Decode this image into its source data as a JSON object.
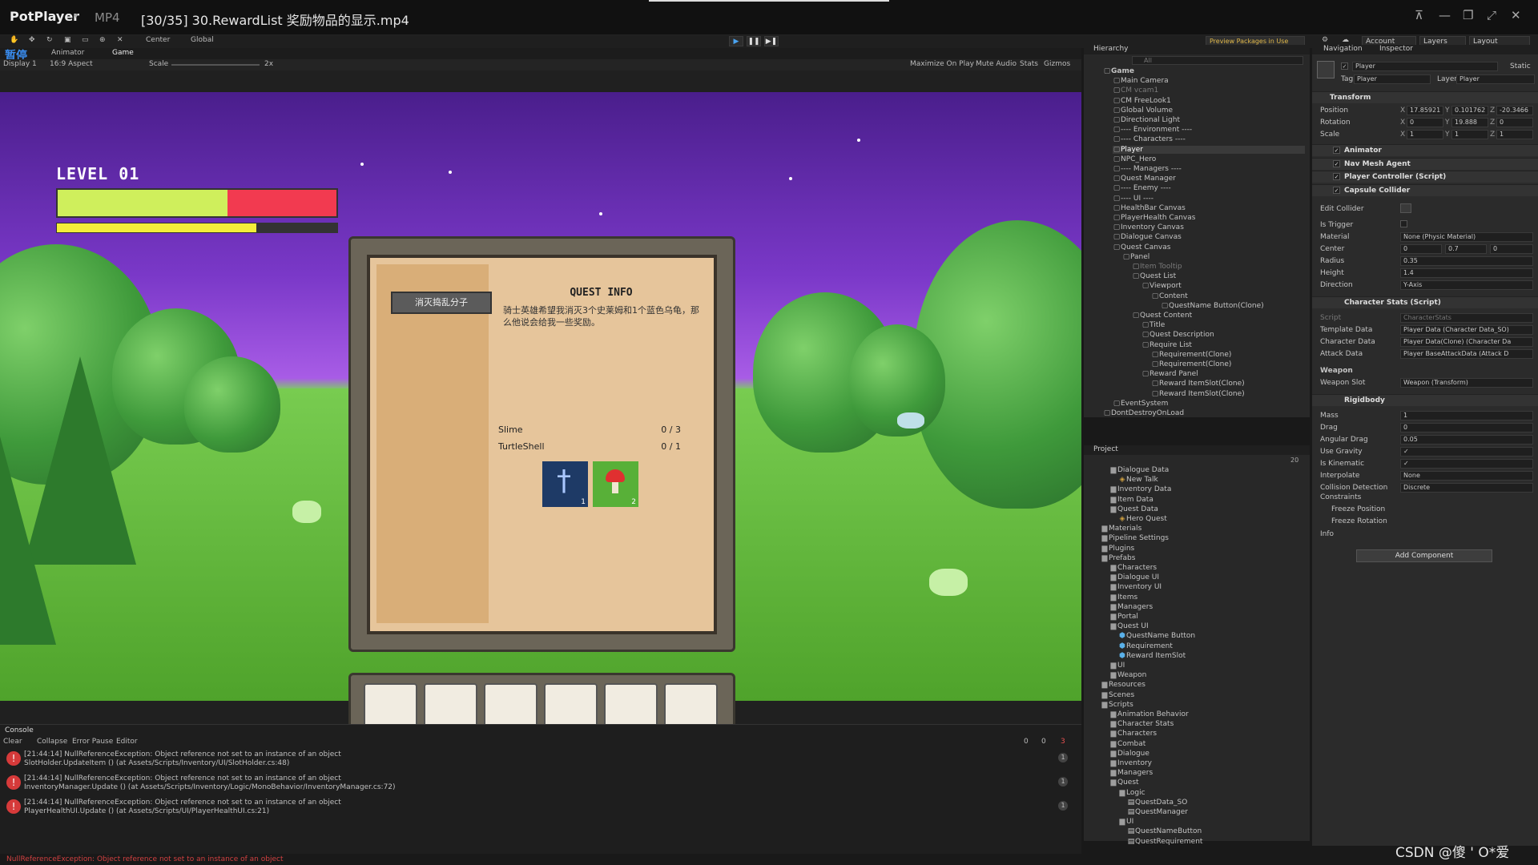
{
  "player": {
    "brand": "PotPlayer",
    "format": "MP4",
    "filename": "[30/35] 30.RewardList 奖励物品的显示.mp4",
    "paused_label": "暂停",
    "watermark": "CSDN @傻  ' O*爱"
  },
  "unity_toolbar": {
    "center": "Center",
    "global": "Global",
    "preview_packages": "Preview Packages in Use",
    "account": "Account",
    "layers": "Layers",
    "layout": "Layout"
  },
  "game_panel": {
    "tabs": [
      "Animator",
      "Game"
    ],
    "display": "Display 1",
    "aspect": "16:9 Aspect",
    "scale_label": "Scale",
    "scale_value": "2x",
    "options": [
      "Maximize On Play",
      "Mute Audio",
      "Stats",
      "Gizmos"
    ]
  },
  "hud": {
    "level_text": "LEVEL 01",
    "health_fraction": 0.61,
    "exp_fraction": 0.71,
    "health_color": "#cfef5c",
    "health_bg_color": "#f23a50",
    "exp_color": "#f3ee3b"
  },
  "quest_ui": {
    "quest_button": "消灭捣乱分子",
    "title": "QUEST INFO",
    "description": "骑士英雄希望我消灭3个史莱姆和1个蓝色乌龟，那么他说会给我一些奖励。",
    "requirements": [
      {
        "name": "Slime",
        "count": "0 / 3"
      },
      {
        "name": "TurtleShell",
        "count": "0 / 1"
      }
    ],
    "rewards": [
      {
        "icon": "sword-icon",
        "amount": "1",
        "color": "#1e3a66"
      },
      {
        "icon": "mushroom-icon",
        "amount": "2",
        "color": "#58b038"
      }
    ]
  },
  "console": {
    "tab": "Console",
    "buttons": [
      "Clear",
      "Collapse",
      "Error Pause",
      "Editor"
    ],
    "counts": [
      "0",
      "0",
      "3"
    ],
    "rows": [
      {
        "line1": "[21:44:14] NullReferenceException: Object reference not set to an instance of an object",
        "line2": "SlotHolder.UpdateItem () (at Assets/Scripts/Inventory/UI/SlotHolder.cs:48)",
        "count": "1"
      },
      {
        "line1": "[21:44:14] NullReferenceException: Object reference not set to an instance of an object",
        "line2": "InventoryManager.Update () (at Assets/Scripts/Inventory/Logic/MonoBehavior/InventoryManager.cs:72)",
        "count": "1"
      },
      {
        "line1": "[21:44:14] NullReferenceException: Object reference not set to an instance of an object",
        "line2": "PlayerHealthUI.Update () (at Assets/Scripts/UI/PlayerHealthUI.cs:21)",
        "count": "1"
      }
    ],
    "status": "NullReferenceException: Object reference not set to an instance of an object"
  },
  "hierarchy": {
    "title": "Hierarchy",
    "search_placeholder": "All",
    "items": [
      {
        "label": "Game",
        "indent": 0,
        "state": "bold"
      },
      {
        "label": "Main Camera",
        "indent": 1,
        "state": ""
      },
      {
        "label": "CM vcam1",
        "indent": 1,
        "state": "dim"
      },
      {
        "label": "CM FreeLook1",
        "indent": 1,
        "state": ""
      },
      {
        "label": "Global Volume",
        "indent": 1,
        "state": ""
      },
      {
        "label": "Directional Light",
        "indent": 1,
        "state": ""
      },
      {
        "label": "---- Environment ----",
        "indent": 1,
        "state": ""
      },
      {
        "label": "---- Characters ----",
        "indent": 1,
        "state": ""
      },
      {
        "label": "Player",
        "indent": 1,
        "state": "sel"
      },
      {
        "label": "NPC_Hero",
        "indent": 1,
        "state": ""
      },
      {
        "label": "---- Managers ----",
        "indent": 1,
        "state": ""
      },
      {
        "label": "Quest Manager",
        "indent": 1,
        "state": ""
      },
      {
        "label": "---- Enemy ----",
        "indent": 1,
        "state": ""
      },
      {
        "label": "---- UI ----",
        "indent": 1,
        "state": ""
      },
      {
        "label": "HealthBar Canvas",
        "indent": 1,
        "state": ""
      },
      {
        "label": "PlayerHealth Canvas",
        "indent": 1,
        "state": ""
      },
      {
        "label": "Inventory Canvas",
        "indent": 1,
        "state": ""
      },
      {
        "label": "Dialogue Canvas",
        "indent": 1,
        "state": ""
      },
      {
        "label": "Quest Canvas",
        "indent": 1,
        "state": ""
      },
      {
        "label": "Panel",
        "indent": 2,
        "state": ""
      },
      {
        "label": "Item Tooltip",
        "indent": 3,
        "state": "dim"
      },
      {
        "label": "Quest List",
        "indent": 3,
        "state": ""
      },
      {
        "label": "Viewport",
        "indent": 4,
        "state": ""
      },
      {
        "label": "Content",
        "indent": 5,
        "state": ""
      },
      {
        "label": "QuestName Button(Clone)",
        "indent": 6,
        "state": ""
      },
      {
        "label": "Quest Content",
        "indent": 3,
        "state": ""
      },
      {
        "label": "Title",
        "indent": 4,
        "state": ""
      },
      {
        "label": "Quest Description",
        "indent": 4,
        "state": ""
      },
      {
        "label": "Require List",
        "indent": 4,
        "state": ""
      },
      {
        "label": "Requirement(Clone)",
        "indent": 5,
        "state": ""
      },
      {
        "label": "Requirement(Clone)",
        "indent": 5,
        "state": ""
      },
      {
        "label": "Reward Panel",
        "indent": 4,
        "state": ""
      },
      {
        "label": "Reward ItemSlot(Clone)",
        "indent": 5,
        "state": ""
      },
      {
        "label": "Reward ItemSlot(Clone)",
        "indent": 5,
        "state": ""
      },
      {
        "label": "EventSystem",
        "indent": 1,
        "state": ""
      },
      {
        "label": "DontDestroyOnLoad",
        "indent": 0,
        "state": ""
      }
    ]
  },
  "project": {
    "title": "Project",
    "count": "20",
    "items": [
      {
        "label": "Dialogue Data",
        "indent": 2,
        "kind": "folder"
      },
      {
        "label": "New Talk",
        "indent": 3,
        "kind": "asset"
      },
      {
        "label": "Inventory Data",
        "indent": 2,
        "kind": "folder"
      },
      {
        "label": "Item Data",
        "indent": 2,
        "kind": "folder"
      },
      {
        "label": "Quest Data",
        "indent": 2,
        "kind": "folder"
      },
      {
        "label": "Hero Quest",
        "indent": 3,
        "kind": "asset"
      },
      {
        "label": "Materials",
        "indent": 1,
        "kind": "folder"
      },
      {
        "label": "Pipeline Settings",
        "indent": 1,
        "kind": "folder"
      },
      {
        "label": "Plugins",
        "indent": 1,
        "kind": "folder"
      },
      {
        "label": "Prefabs",
        "indent": 1,
        "kind": "folder"
      },
      {
        "label": "Characters",
        "indent": 2,
        "kind": "folder"
      },
      {
        "label": "Dialogue UI",
        "indent": 2,
        "kind": "folder"
      },
      {
        "label": "Inventory UI",
        "indent": 2,
        "kind": "folder"
      },
      {
        "label": "Items",
        "indent": 2,
        "kind": "folder"
      },
      {
        "label": "Managers",
        "indent": 2,
        "kind": "folder"
      },
      {
        "label": "Portal",
        "indent": 2,
        "kind": "folder"
      },
      {
        "label": "Quest UI",
        "indent": 2,
        "kind": "folder"
      },
      {
        "label": "QuestName Button",
        "indent": 3,
        "kind": "prefab"
      },
      {
        "label": "Requirement",
        "indent": 3,
        "kind": "prefab"
      },
      {
        "label": "Reward ItemSlot",
        "indent": 3,
        "kind": "prefab"
      },
      {
        "label": "UI",
        "indent": 2,
        "kind": "folder"
      },
      {
        "label": "Weapon",
        "indent": 2,
        "kind": "folder"
      },
      {
        "label": "Resources",
        "indent": 1,
        "kind": "folder"
      },
      {
        "label": "Scenes",
        "indent": 1,
        "kind": "folder"
      },
      {
        "label": "Scripts",
        "indent": 1,
        "kind": "folder"
      },
      {
        "label": "Animation Behavior",
        "indent": 2,
        "kind": "folder"
      },
      {
        "label": "Character Stats",
        "indent": 2,
        "kind": "folder"
      },
      {
        "label": "Characters",
        "indent": 2,
        "kind": "folder"
      },
      {
        "label": "Combat",
        "indent": 2,
        "kind": "folder"
      },
      {
        "label": "Dialogue",
        "indent": 2,
        "kind": "folder"
      },
      {
        "label": "Inventory",
        "indent": 2,
        "kind": "folder"
      },
      {
        "label": "Managers",
        "indent": 2,
        "kind": "folder"
      },
      {
        "label": "Quest",
        "indent": 2,
        "kind": "folder"
      },
      {
        "label": "Logic",
        "indent": 3,
        "kind": "folder"
      },
      {
        "label": "QuestData_SO",
        "indent": 4,
        "kind": "script"
      },
      {
        "label": "QuestManager",
        "indent": 4,
        "kind": "script"
      },
      {
        "label": "UI",
        "indent": 3,
        "kind": "folder"
      },
      {
        "label": "QuestNameButton",
        "indent": 4,
        "kind": "script"
      },
      {
        "label": "QuestRequirement",
        "indent": 4,
        "kind": "script"
      }
    ]
  },
  "inspector": {
    "tabs": [
      "Navigation",
      "Inspector"
    ],
    "object_name": "Player",
    "static_label": "Static",
    "tag_label": "Tag",
    "tag_value": "Player",
    "layer_label": "Layer",
    "layer_value": "Player",
    "transform": {
      "title": "Transform",
      "position": {
        "label": "Position",
        "x": "17.85921",
        "y": "0.101762",
        "z": "-20.3466"
      },
      "rotation": {
        "label": "Rotation",
        "x": "0",
        "y": "19.888",
        "z": "0"
      },
      "scale": {
        "label": "Scale",
        "x": "1",
        "y": "1",
        "z": "1"
      }
    },
    "components": [
      "Animator",
      "Nav Mesh Agent",
      "Player Controller (Script)",
      "Capsule Collider"
    ],
    "collider": {
      "edit": "Edit Collider",
      "is_trigger": "Is Trigger",
      "material_label": "Material",
      "material": "None (Physic Material)",
      "center_label": "Center",
      "center": {
        "x": "0",
        "y": "0.7",
        "z": "0"
      },
      "radius_label": "Radius",
      "radius": "0.35",
      "height_label": "Height",
      "height": "1.4",
      "direction_label": "Direction",
      "direction": "Y-Axis"
    },
    "stats": {
      "title": "Character Stats (Script)",
      "script_label": "Script",
      "script": "CharacterStats",
      "template_label": "Template Data",
      "template": "Player Data (Character Data_SO)",
      "char_label": "Character Data",
      "char": "Player Data(Clone) (Character Da",
      "attack_label": "Attack Data",
      "attack": "Player BaseAttackData (Attack D",
      "weapon_header": "Weapon",
      "weapon_label": "Weapon Slot",
      "weapon": "Weapon (Transform)"
    },
    "rigidbody": {
      "title": "Rigidbody",
      "rows": [
        {
          "label": "Mass",
          "value": "1"
        },
        {
          "label": "Drag",
          "value": "0"
        },
        {
          "label": "Angular Drag",
          "value": "0.05"
        },
        {
          "label": "Use Gravity",
          "value": "✓"
        },
        {
          "label": "Is Kinematic",
          "value": "✓"
        },
        {
          "label": "Interpolate",
          "value": "None"
        },
        {
          "label": "Collision Detection",
          "value": "Discrete"
        }
      ],
      "constraints": "Constraints",
      "freeze_pos": "Freeze Position",
      "freeze_rot": "Freeze Rotation",
      "info": "Info"
    },
    "add_component": "Add Component"
  }
}
